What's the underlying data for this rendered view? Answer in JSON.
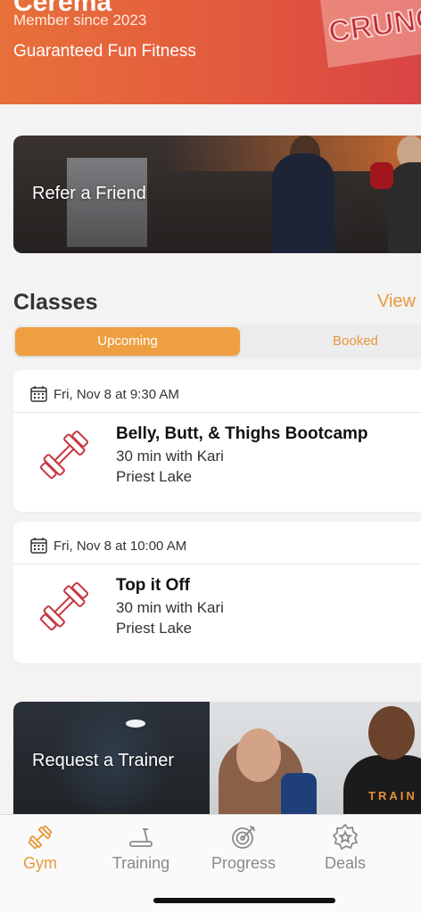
{
  "header": {
    "name": "Cerema",
    "member_since": "Member since 2023",
    "tagline": "Guaranteed Fun Fitness",
    "logo_text": "CRUNCH",
    "colors": {
      "start": "#e8703a",
      "end": "#d84444"
    }
  },
  "promos": {
    "refer": "Refer a Friend",
    "trainer": "Request a Trainer",
    "trainer_shirt": "TRAIN"
  },
  "classes": {
    "title": "Classes",
    "view_label": "View",
    "tabs": {
      "upcoming": "Upcoming",
      "booked": "Booked"
    },
    "items": [
      {
        "date": "Fri, Nov 8 at 9:30 AM",
        "name": "Belly, Butt, & Thighs Bootcamp",
        "duration": "30 min with Kari",
        "location": "Priest Lake",
        "icon": "barbell-icon"
      },
      {
        "date": "Fri, Nov 8 at 10:00 AM",
        "name": "Top it Off",
        "duration": "30 min with Kari",
        "location": "Priest Lake",
        "icon": "barbell-icon"
      }
    ]
  },
  "tabbar": {
    "gym": "Gym",
    "training": "Training",
    "progress": "Progress",
    "deals": "Deals",
    "active": "Gym"
  },
  "colors": {
    "accent": "#e9983a",
    "barbell": "#c7353d"
  }
}
